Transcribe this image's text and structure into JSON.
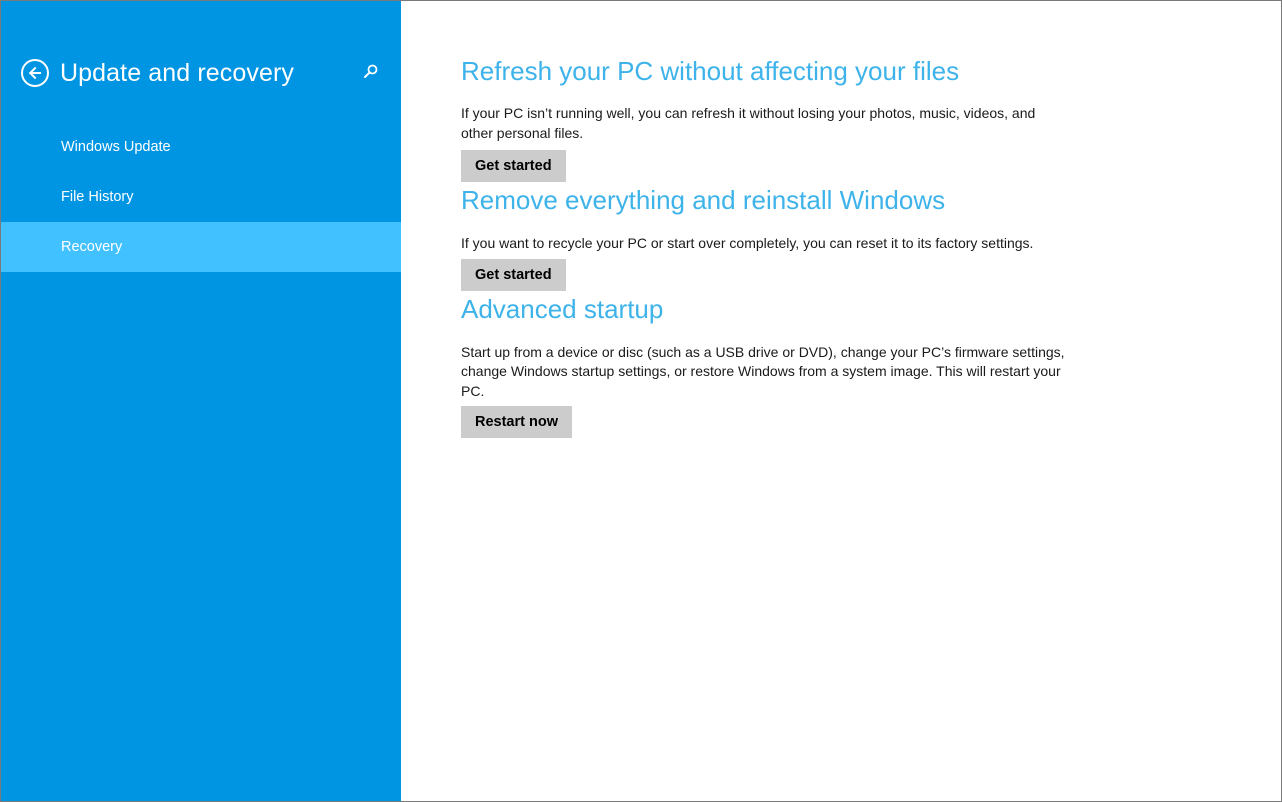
{
  "sidebar": {
    "title": "Update and recovery",
    "back_icon": "back-arrow-icon",
    "search_icon": "search-icon",
    "background_color": "#0095e2",
    "active_color": "#41c1ff",
    "items": [
      {
        "label": "Windows Update",
        "active": false
      },
      {
        "label": "File History",
        "active": false
      },
      {
        "label": "Recovery",
        "active": true
      }
    ]
  },
  "main": {
    "heading_color": "#3db3ea",
    "sections": [
      {
        "heading": "Refresh your PC without affecting your files",
        "description": "If your PC isn’t running well, you can refresh it without losing your photos, music, videos, and other personal files.",
        "button_label": "Get started"
      },
      {
        "heading": "Remove everything and reinstall Windows",
        "description": "If you want to recycle your PC or start over completely, you can reset it to its factory settings.",
        "button_label": "Get started"
      },
      {
        "heading": "Advanced startup",
        "description": "Start up from a device or disc (such as a USB drive or DVD), change your PC’s firmware settings, change Windows startup settings, or restore Windows from a system image. This will restart your PC.",
        "button_label": "Restart now"
      }
    ]
  }
}
